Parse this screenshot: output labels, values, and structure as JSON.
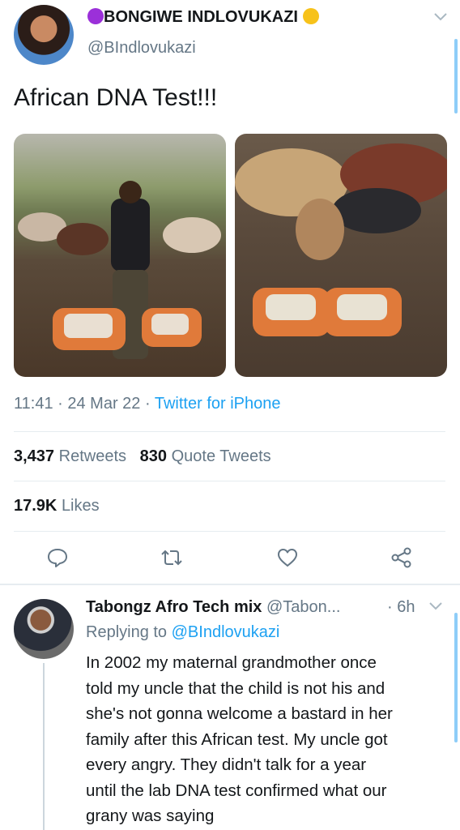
{
  "tweet": {
    "author_name": "BONGIWE INDLOVUKAZI",
    "author_handle": "@BIndlovukazi",
    "text": "African DNA Test!!!",
    "time": "11:41",
    "date": "24 Mar 22",
    "source": "Twitter for iPhone",
    "retweets_count": "3,437",
    "retweets_label": "Retweets",
    "quotes_count": "830",
    "quotes_label": "Quote Tweets",
    "likes_count": "17.9K",
    "likes_label": "Likes",
    "icons": [
      "purple-circle-emoji-icon",
      "yellow-circle-emoji-icon",
      "chevron-down-icon",
      "reply-icon",
      "retweet-icon",
      "like-icon",
      "share-icon"
    ],
    "colors": {
      "accent": "#1da1f2",
      "muted": "#657786",
      "text": "#14171a",
      "divider": "#e6ecf0"
    }
  },
  "reply": {
    "author_name": "Tabongz Afro Tech mix",
    "author_handle": "@Tabon...",
    "age": "6h",
    "replying_to_prefix": "Replying to",
    "replying_to_handle": "@BIndlovukazi",
    "text_lines": [
      "In 2002 my maternal grandmother once",
      "told my uncle that the child is not his and",
      "she's not gonna welcome a bastard in her",
      "family after this African test. My uncle got",
      "every angry. They didn't talk for a year",
      "until the lab DNA test confirmed what our",
      "grany was saying"
    ]
  }
}
